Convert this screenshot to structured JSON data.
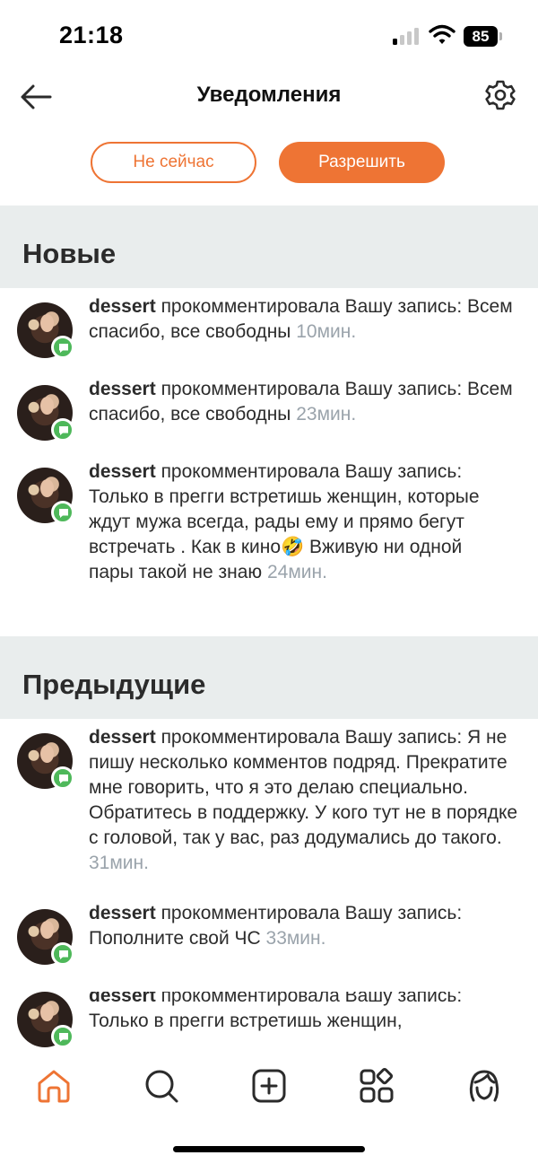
{
  "status_bar": {
    "time": "21:18",
    "battery": "85"
  },
  "header": {
    "title": "Уведомления",
    "back_icon": "arrow-left-icon",
    "settings_icon": "gear-icon"
  },
  "permission": {
    "not_now_label": "Не сейчас",
    "allow_label": "Разрешить"
  },
  "colors": {
    "accent": "#ee7434",
    "section_bg": "#e9eded",
    "badge_green": "#4eb85a",
    "time_gray": "#9aa3ab"
  },
  "sections": {
    "new_title": "Новые",
    "previous_title": "Предыдущие"
  },
  "new_notifications": [
    {
      "user": "dessert",
      "action": "прокомментировала Вашу запись:",
      "text": "Всем спасибо, все свободны",
      "time": "10мин."
    },
    {
      "user": "dessert",
      "action": "прокомментировала Вашу запись:",
      "text": "Всем спасибо, все свободны",
      "time": "23мин."
    },
    {
      "user": "dessert",
      "action": "прокомментировала Вашу запись:",
      "text": "Только в прегги встретишь женщин, которые ждут мужа всегда, рады ему и прямо бегут встречать . Как в кино🤣 Вживую ни одной пары такой не знаю",
      "time": "24мин."
    }
  ],
  "previous_notifications": [
    {
      "user": "dessert",
      "action": "прокомментировала Вашу запись:",
      "text": "Я не пишу несколько комментов подряд. Прекратите мне говорить, что я это делаю специально. Обратитесь в поддержку. У кого тут не в порядке с головой, так у вас, раз додумались до такого.",
      "time": "31мин."
    },
    {
      "user": "dessert",
      "action": "прокомментировала Вашу запись:",
      "text": "Пополните свой ЧС",
      "time": "33мин."
    },
    {
      "user": "dessert",
      "action": "прокомментировала Вашу запись:",
      "text": "Только в прегги встретишь женщин,",
      "time": ""
    }
  ],
  "bottom_nav": [
    {
      "icon": "home-icon",
      "active": true
    },
    {
      "icon": "search-icon",
      "active": false
    },
    {
      "icon": "add-post-icon",
      "active": false
    },
    {
      "icon": "services-grid-icon",
      "active": false
    },
    {
      "icon": "profile-icon",
      "active": false
    }
  ]
}
